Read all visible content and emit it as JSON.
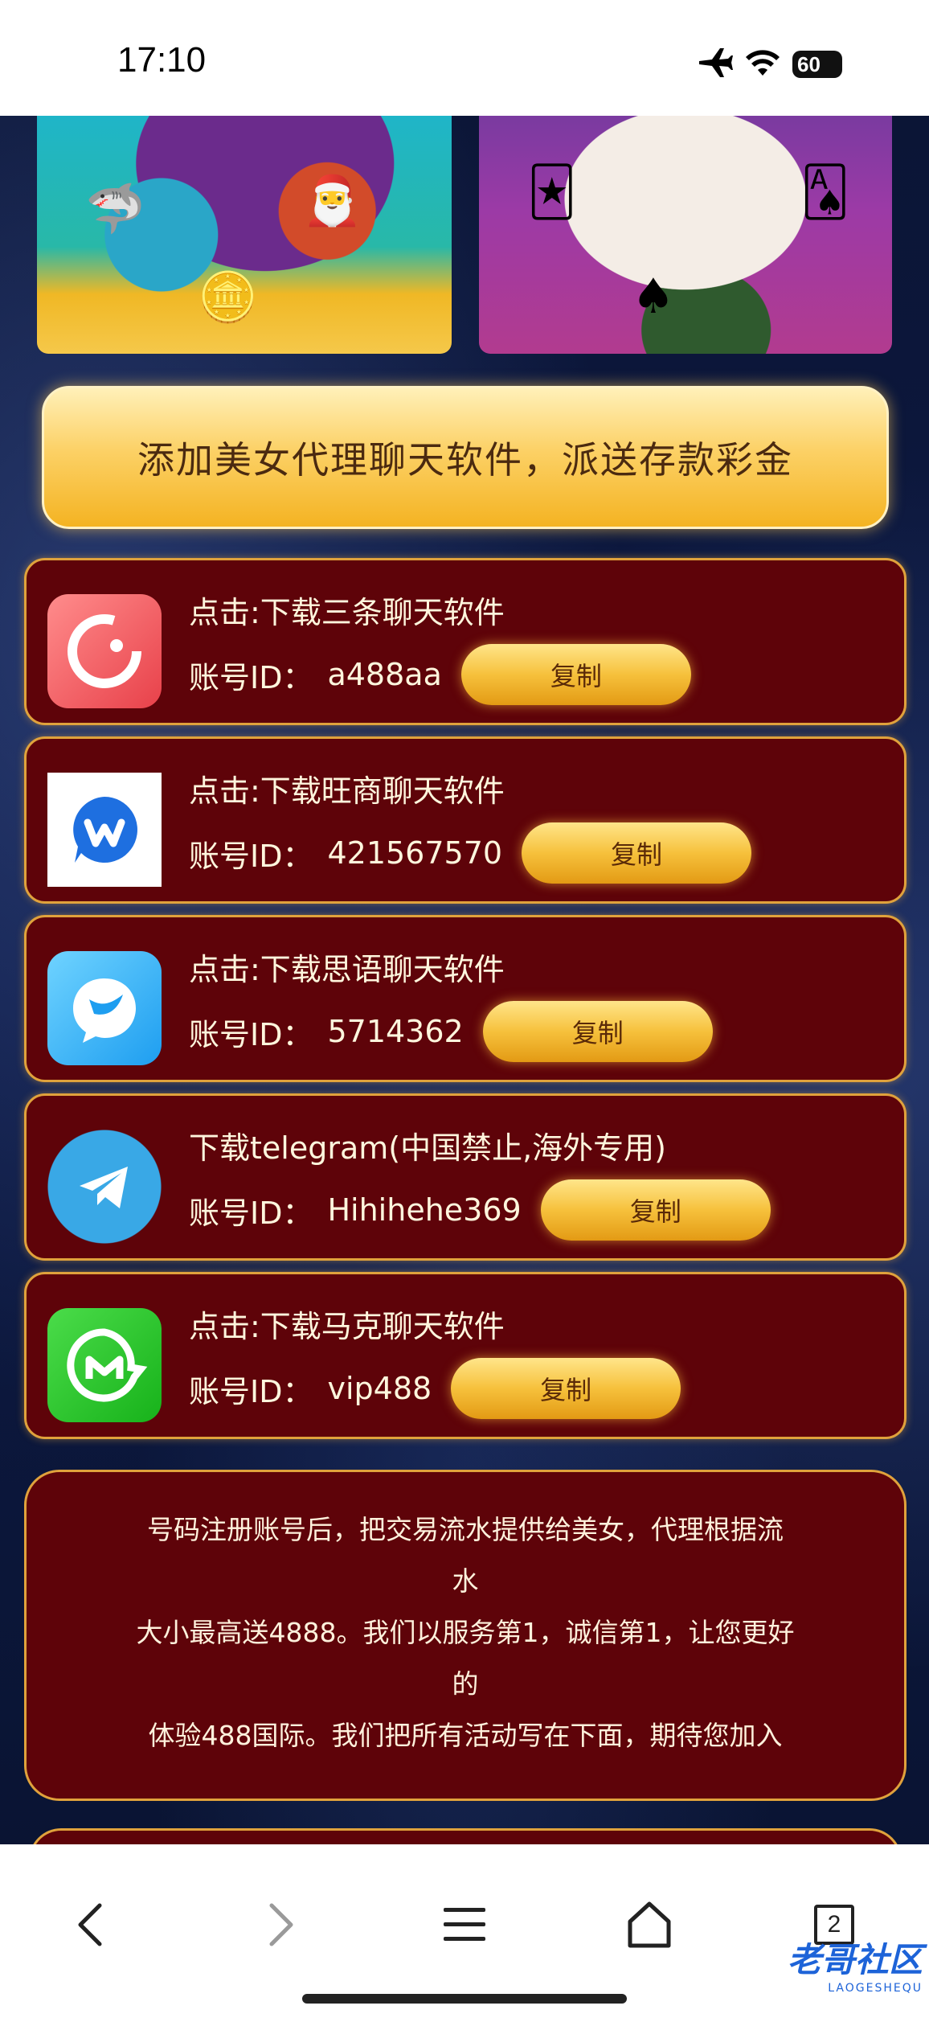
{
  "status_bar": {
    "time": "17:10",
    "battery": "60"
  },
  "promo": {
    "text": "添加美女代理聊天软件，派送存款彩金"
  },
  "cards": [
    {
      "title": "点击:下载三条聊天软件",
      "account_label": "账号ID：",
      "account_id": "a488aa",
      "copy_label": "复制",
      "icon": "sanjiao-chat-icon"
    },
    {
      "title": "点击:下载旺商聊天软件",
      "account_label": "账号ID：",
      "account_id": "421567570",
      "copy_label": "复制",
      "icon": "wangshang-chat-icon"
    },
    {
      "title": "点击:下载思语聊天软件",
      "account_label": "账号ID：",
      "account_id": "5714362",
      "copy_label": "复制",
      "icon": "siyu-chat-icon"
    },
    {
      "title": "下载telegram(中国禁止,海外专用)",
      "account_label": "账号ID：",
      "account_id": "Hihihehe369",
      "copy_label": "复制",
      "icon": "telegram-icon"
    },
    {
      "title": "点击:下载马克聊天软件",
      "account_label": "账号ID：",
      "account_id": "vip488",
      "copy_label": "复制",
      "icon": "make-chat-icon"
    }
  ],
  "info": {
    "lines": [
      "号码注册账号后，把交易流水提供给美女，代理根据流",
      "水",
      "大小最高送4888。我们以服务第1，诚信第1，让您更好",
      "的",
      "体验488国际。我们把所有活动写在下面，期待您加入"
    ]
  },
  "bottom_nav": {
    "tab_count": "2"
  },
  "watermark": {
    "cn": "老哥社区",
    "en": "LAOGESHEQU"
  },
  "colors": {
    "card_bg": "#5e0309",
    "card_border": "#e0a23c",
    "gold": "#f6c13c"
  }
}
